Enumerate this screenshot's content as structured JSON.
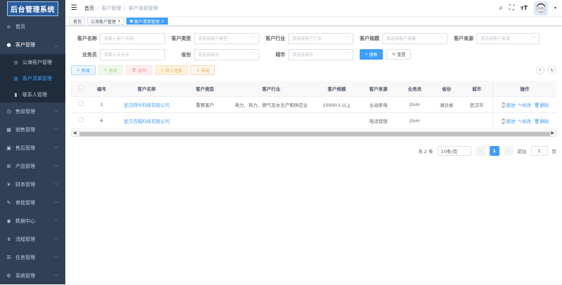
{
  "app": {
    "logo_text": "后台管理系统"
  },
  "sidebar": {
    "items": [
      {
        "label": "首页",
        "icon": "home-icon"
      },
      {
        "label": "客户管理",
        "icon": "user-icon",
        "expanded": true
      },
      {
        "label": "售前管理",
        "icon": "presale-icon"
      },
      {
        "label": "销售管理",
        "icon": "sales-icon"
      },
      {
        "label": "售后管理",
        "icon": "aftersale-icon"
      },
      {
        "label": "产品管理",
        "icon": "product-icon"
      },
      {
        "label": "财务管理",
        "icon": "finance-icon"
      },
      {
        "label": "审批管理",
        "icon": "approval-icon"
      },
      {
        "label": "数据中心",
        "icon": "data-icon"
      },
      {
        "label": "流程管理",
        "icon": "flow-icon"
      },
      {
        "label": "任务管理",
        "icon": "task-icon"
      },
      {
        "label": "系统管理",
        "icon": "system-icon"
      }
    ],
    "sub_items": [
      {
        "label": "公海客户管理",
        "icon": "pool-icon"
      },
      {
        "label": "客户清单管理",
        "icon": "list-icon",
        "active": true
      },
      {
        "label": "联系人管理",
        "icon": "contact-icon"
      }
    ]
  },
  "navbar": {
    "breadcrumb": [
      "首页",
      "客户管理",
      "客户清单管理"
    ]
  },
  "tags": [
    {
      "label": "首页"
    },
    {
      "label": "公海客户管理",
      "closable": "×"
    },
    {
      "label": "客户清单管理",
      "closable": "×",
      "active": true
    }
  ],
  "search": {
    "fields": [
      {
        "label": "客户名称",
        "placeholder": "请输入客户名称",
        "type": "input"
      },
      {
        "label": "客户类型",
        "placeholder": "请选择客户类型",
        "type": "select"
      },
      {
        "label": "客户行业",
        "placeholder": "请选择客户行业",
        "type": "select"
      },
      {
        "label": "客户规模",
        "placeholder": "请选择客户规模",
        "type": "select"
      },
      {
        "label": "客户来源",
        "placeholder": "请选择客户来源",
        "type": "select"
      }
    ],
    "fields2": [
      {
        "label": "业务员",
        "placeholder": "请输入业务员",
        "type": "input"
      },
      {
        "label": "省份",
        "placeholder": "请选择省份",
        "type": "select"
      },
      {
        "label": "城市",
        "placeholder": "请选择城市",
        "type": "select"
      }
    ],
    "search_label": "搜索",
    "reset_label": "重置"
  },
  "toolbar": {
    "add": "新增",
    "edit": "修改",
    "delete": "删除",
    "import": "导入任务",
    "export": "导出"
  },
  "table": {
    "columns": [
      "编号",
      "客户名称",
      "客户类型",
      "客户行业",
      "客户规模",
      "客户来源",
      "业务员",
      "省份",
      "城市",
      "操作"
    ],
    "rows": [
      {
        "id": "1",
        "name": "武汉特牛科技有限公司",
        "type": "重要客户",
        "industry": "电力、热力、燃气及水生产和供应业",
        "scale": "10000人以上",
        "source": "主动来电",
        "sales": "jtom",
        "province": "湖北省",
        "city": "武汉市"
      },
      {
        "id": "6",
        "name": "武汉百猫科技有限公司",
        "type": "",
        "industry": "",
        "scale": "",
        "source": "电话营销",
        "sales": "jtom",
        "province": "",
        "city": ""
      }
    ],
    "ops": {
      "follow": "跟进",
      "edit": "修改",
      "delete": "删除"
    }
  },
  "pager": {
    "total": "共 2 条",
    "size": "10条/页",
    "page": "1",
    "goto": "前往",
    "goto_value": "1",
    "page_unit": "页"
  }
}
